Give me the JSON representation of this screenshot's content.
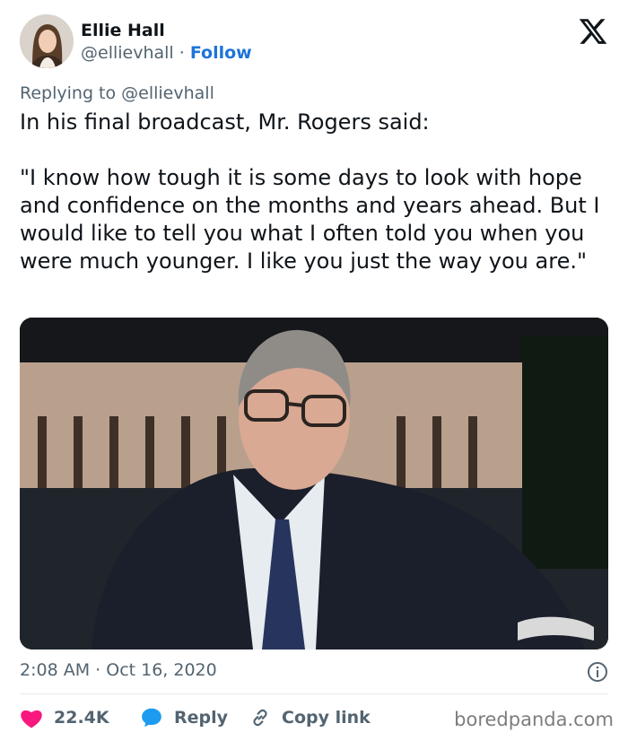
{
  "author": {
    "name": "Ellie Hall",
    "handle": "@ellievhall",
    "separator": " · ",
    "follow_label": "Follow"
  },
  "replying": {
    "prefix": "Replying to ",
    "mention": "@ellievhall"
  },
  "tweet": {
    "text": "In his final broadcast, Mr. Rogers said:\n\n\"I know how tough it is some days to look with hope and confidence on the months and years ahead. But I would like to tell you what I often told you when you were much younger. I like you just the way you are.\""
  },
  "meta": {
    "time": "2:08 AM",
    "separator": " · ",
    "date": "Oct 16, 2020"
  },
  "actions": {
    "likes": "22.4K",
    "reply_label": "Reply",
    "copy_label": "Copy link"
  },
  "watermark": "boredpanda.com",
  "icons": {
    "platform_logo": "x-logo-icon",
    "info": "info-icon",
    "like": "heart-icon",
    "reply": "speech-bubble-icon",
    "copy": "link-icon"
  },
  "colors": {
    "link_blue": "#1d74d8",
    "like_red": "#f91880",
    "reply_blue": "#1d9bf0",
    "muted": "#536471",
    "text": "#0f1419"
  }
}
